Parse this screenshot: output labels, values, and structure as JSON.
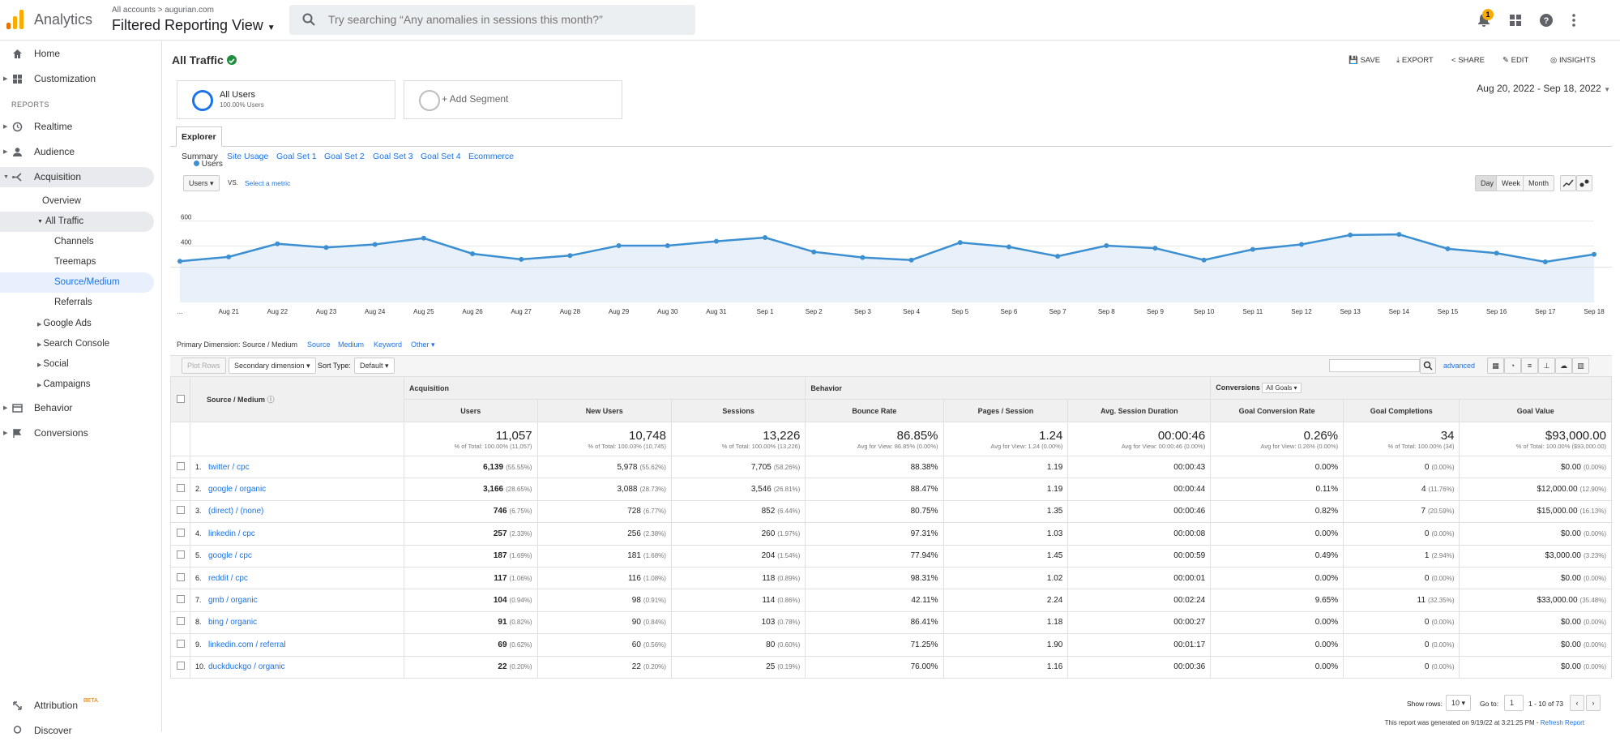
{
  "app": {
    "name": "Analytics",
    "breadcrumb": "All accounts > augurian.com",
    "view": "Filtered Reporting View",
    "search_placeholder": "Try searching “Any anomalies in sessions this month?”",
    "notification_count": "1"
  },
  "sidebar": {
    "home": "Home",
    "customization": "Customization",
    "reports_label": "REPORTS",
    "realtime": "Realtime",
    "audience": "Audience",
    "acquisition": "Acquisition",
    "overview": "Overview",
    "all_traffic": "All Traffic",
    "channels": "Channels",
    "treemaps": "Treemaps",
    "source_medium": "Source/Medium",
    "referrals": "Referrals",
    "google_ads": "Google Ads",
    "search_console": "Search Console",
    "social": "Social",
    "campaigns": "Campaigns",
    "behavior": "Behavior",
    "conversions": "Conversions",
    "attribution": "Attribution",
    "beta": "BETA",
    "discover": "Discover"
  },
  "header": {
    "title": "All Traffic",
    "actions": [
      "SAVE",
      "EXPORT",
      "SHARE",
      "EDIT",
      "INSIGHTS"
    ]
  },
  "segments": {
    "seg1_title": "All Users",
    "seg1_sub": "100.00% Users",
    "add": "+ Add Segment"
  },
  "date_range": "Aug 20, 2022 - Sep 18, 2022",
  "tabs": {
    "explorer": "Explorer",
    "subtabs": [
      "Summary",
      "Site Usage",
      "Goal Set 1",
      "Goal Set 2",
      "Goal Set 3",
      "Goal Set 4",
      "Ecommerce"
    ]
  },
  "metric_controls": {
    "metric": "Users",
    "vs": "VS.",
    "select": "Select a metric",
    "periods": [
      "Day",
      "Week",
      "Month"
    ]
  },
  "chart_data": {
    "type": "line",
    "title": "",
    "legend": [
      "Users"
    ],
    "color": "#3c8fd0",
    "x": [
      "...",
      "Aug 21",
      "Aug 22",
      "Aug 23",
      "Aug 24",
      "Aug 25",
      "Aug 26",
      "Aug 27",
      "Aug 28",
      "Aug 29",
      "Aug 30",
      "Aug 31",
      "Sep 1",
      "Sep 2",
      "Sep 3",
      "Sep 4",
      "Sep 5",
      "Sep 6",
      "Sep 7",
      "Sep 8",
      "Sep 9",
      "Sep 10",
      "Sep 11",
      "Sep 12",
      "Sep 13",
      "Sep 14",
      "Sep 15",
      "Sep 16",
      "Sep 17",
      "Sep 18"
    ],
    "series": [
      {
        "name": "Users",
        "values": [
          330,
          365,
          470,
          440,
          465,
          515,
          390,
          345,
          375,
          455,
          455,
          490,
          520,
          405,
          360,
          340,
          480,
          445,
          370,
          455,
          435,
          340,
          425,
          465,
          540,
          545,
          430,
          395,
          325,
          385
        ]
      }
    ],
    "ylim": [
      0,
      650
    ],
    "yticks": [
      "600",
      "400",
      "200"
    ],
    "grid": true
  },
  "dimension": {
    "label": "Primary Dimension:",
    "current": "Source / Medium",
    "options": [
      "Source",
      "Medium",
      "Keyword",
      "Other"
    ]
  },
  "controls": {
    "plot_rows": "Plot Rows",
    "secondary": "Secondary dimension",
    "sort_label": "Sort Type:",
    "sort": "Default",
    "advanced": "advanced"
  },
  "table": {
    "group_headers": [
      "Acquisition",
      "Behavior",
      "Conversions"
    ],
    "goal_select": "All Goals",
    "dim_header": "Source / Medium",
    "columns": [
      "Users",
      "New Users",
      "Sessions",
      "Bounce Rate",
      "Pages / Session",
      "Avg. Session Duration",
      "Goal Conversion Rate",
      "Goal Completions",
      "Goal Value"
    ],
    "totals": [
      {
        "v": "11,057",
        "s": "% of Total: 100.00% (11,057)"
      },
      {
        "v": "10,748",
        "s": "% of Total: 100.03% (10,745)"
      },
      {
        "v": "13,226",
        "s": "% of Total: 100.00% (13,226)"
      },
      {
        "v": "86.85%",
        "s": "Avg for View: 86.85% (0.00%)"
      },
      {
        "v": "1.24",
        "s": "Avg for View: 1.24 (0.00%)"
      },
      {
        "v": "00:00:46",
        "s": "Avg for View: 00:00:46 (0.00%)"
      },
      {
        "v": "0.26%",
        "s": "Avg for View: 0.26% (0.00%)"
      },
      {
        "v": "34",
        "s": "% of Total: 100.00% (34)"
      },
      {
        "v": "$93,000.00",
        "s": "% of Total: 100.00% ($93,000.00)"
      }
    ],
    "rows": [
      {
        "n": "1.",
        "src": "twitter / cpc",
        "u": "6,139",
        "up": "(55.55%)",
        "nu": "5,978",
        "nup": "(55.62%)",
        "s": "7,705",
        "sp": "(58.26%)",
        "br": "88.38%",
        "ps": "1.19",
        "d": "00:00:43",
        "cr": "0.00%",
        "gc": "0",
        "gcp": "(0.00%)",
        "gv": "$0.00",
        "gvp": "(0.00%)"
      },
      {
        "n": "2.",
        "src": "google / organic",
        "u": "3,166",
        "up": "(28.65%)",
        "nu": "3,088",
        "nup": "(28.73%)",
        "s": "3,546",
        "sp": "(26.81%)",
        "br": "88.47%",
        "ps": "1.19",
        "d": "00:00:44",
        "cr": "0.11%",
        "gc": "4",
        "gcp": "(11.76%)",
        "gv": "$12,000.00",
        "gvp": "(12.90%)"
      },
      {
        "n": "3.",
        "src": "(direct) / (none)",
        "u": "746",
        "up": "(6.75%)",
        "nu": "728",
        "nup": "(6.77%)",
        "s": "852",
        "sp": "(6.44%)",
        "br": "80.75%",
        "ps": "1.35",
        "d": "00:00:46",
        "cr": "0.82%",
        "gc": "7",
        "gcp": "(20.59%)",
        "gv": "$15,000.00",
        "gvp": "(16.13%)"
      },
      {
        "n": "4.",
        "src": "linkedin / cpc",
        "u": "257",
        "up": "(2.33%)",
        "nu": "256",
        "nup": "(2.38%)",
        "s": "260",
        "sp": "(1.97%)",
        "br": "97.31%",
        "ps": "1.03",
        "d": "00:00:08",
        "cr": "0.00%",
        "gc": "0",
        "gcp": "(0.00%)",
        "gv": "$0.00",
        "gvp": "(0.00%)"
      },
      {
        "n": "5.",
        "src": "google / cpc",
        "u": "187",
        "up": "(1.69%)",
        "nu": "181",
        "nup": "(1.68%)",
        "s": "204",
        "sp": "(1.54%)",
        "br": "77.94%",
        "ps": "1.45",
        "d": "00:00:59",
        "cr": "0.49%",
        "gc": "1",
        "gcp": "(2.94%)",
        "gv": "$3,000.00",
        "gvp": "(3.23%)"
      },
      {
        "n": "6.",
        "src": "reddit / cpc",
        "u": "117",
        "up": "(1.06%)",
        "nu": "116",
        "nup": "(1.08%)",
        "s": "118",
        "sp": "(0.89%)",
        "br": "98.31%",
        "ps": "1.02",
        "d": "00:00:01",
        "cr": "0.00%",
        "gc": "0",
        "gcp": "(0.00%)",
        "gv": "$0.00",
        "gvp": "(0.00%)"
      },
      {
        "n": "7.",
        "src": "gmb / organic",
        "u": "104",
        "up": "(0.94%)",
        "nu": "98",
        "nup": "(0.91%)",
        "s": "114",
        "sp": "(0.86%)",
        "br": "42.11%",
        "ps": "2.24",
        "d": "00:02:24",
        "cr": "9.65%",
        "gc": "11",
        "gcp": "(32.35%)",
        "gv": "$33,000.00",
        "gvp": "(35.48%)"
      },
      {
        "n": "8.",
        "src": "bing / organic",
        "u": "91",
        "up": "(0.82%)",
        "nu": "90",
        "nup": "(0.84%)",
        "s": "103",
        "sp": "(0.78%)",
        "br": "86.41%",
        "ps": "1.18",
        "d": "00:00:27",
        "cr": "0.00%",
        "gc": "0",
        "gcp": "(0.00%)",
        "gv": "$0.00",
        "gvp": "(0.00%)"
      },
      {
        "n": "9.",
        "src": "linkedin.com / referral",
        "u": "69",
        "up": "(0.62%)",
        "nu": "60",
        "nup": "(0.56%)",
        "s": "80",
        "sp": "(0.60%)",
        "br": "71.25%",
        "ps": "1.90",
        "d": "00:01:17",
        "cr": "0.00%",
        "gc": "0",
        "gcp": "(0.00%)",
        "gv": "$0.00",
        "gvp": "(0.00%)"
      },
      {
        "n": "10.",
        "src": "duckduckgo / organic",
        "u": "22",
        "up": "(0.20%)",
        "nu": "22",
        "nup": "(0.20%)",
        "s": "25",
        "sp": "(0.19%)",
        "br": "76.00%",
        "ps": "1.16",
        "d": "00:00:36",
        "cr": "0.00%",
        "gc": "0",
        "gcp": "(0.00%)",
        "gv": "$0.00",
        "gvp": "(0.00%)"
      }
    ]
  },
  "pagination": {
    "show_rows_label": "Show rows:",
    "rows": "10",
    "goto_label": "Go to:",
    "goto": "1",
    "range": "1 - 10 of 73"
  },
  "footer": {
    "generated": "This report was generated on 9/19/22 at 3:21:25 PM -",
    "refresh": "Refresh Report"
  }
}
